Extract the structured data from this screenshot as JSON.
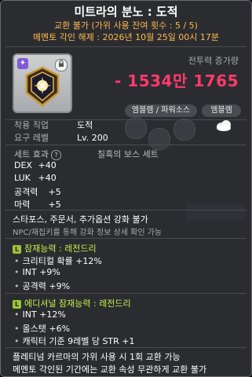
{
  "header": {
    "item_name": "미트라의 분노 : 도적",
    "trade_info": "교환 불가 (가위 사용 잔여 횟수 : 5 / 5)",
    "memento_info": "메멘토 각인 해제 : 2026년 10월 25일 00시 17분"
  },
  "power": {
    "label": "전투력 증가량",
    "value": "- 1534만 1765"
  },
  "buttons": {
    "emblem_power": "엠블렘 / 파워소스",
    "emblem": "엠블렘"
  },
  "requirements": [
    {
      "label": "착용 직업",
      "value": "도적"
    },
    {
      "label": "요구 레벨",
      "value": "Lv. 200"
    }
  ],
  "set": {
    "label": "세트 효과",
    "name": "칠흑의 보스 세트"
  },
  "stats": [
    {
      "name": "DEX",
      "value": "+40"
    },
    {
      "name": "LUK",
      "value": "+40"
    },
    {
      "name": "공격력",
      "value": "+5"
    },
    {
      "name": "마력",
      "value": "+5"
    }
  ],
  "notes": {
    "upgrade": "스타포스, 주문서, 추가옵션 강화 불가",
    "npc": "NPC/재집키를 통해 강화 정보 상세 확인 가능"
  },
  "potential": {
    "badge": "L",
    "title": "잠재능력 : 레전드리",
    "lines": [
      "크리티컬 확률 +12%",
      "INT +9%",
      "공격력 +9%"
    ]
  },
  "additional": {
    "badge": "L",
    "title": "에디셔널 잠재능력 : 레전드리",
    "lines": [
      "INT +12%",
      "올스탯 +6%",
      "캐릭터 기준 9레벨 당 STR +1"
    ]
  },
  "footer": [
    "플레티넘 카르마의 가위 사용 시 1회 교환 가능",
    "메멘토 각인된 기간에는 교환 속성 무관하게 교환 불가"
  ],
  "icons": {
    "star_badge": "✦",
    "lock_badge": "🔒"
  },
  "colors": {
    "power": "#ff3a6b",
    "trade": "#ffb84d",
    "potential": "#c6f04a"
  }
}
